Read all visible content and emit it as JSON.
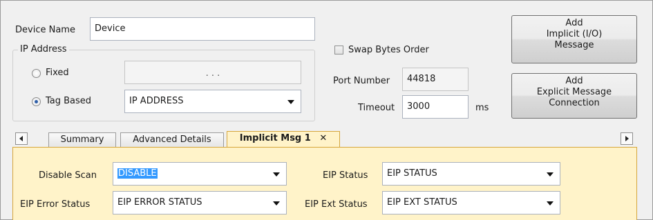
{
  "device": {
    "name_label": "Device Name",
    "name_value": "Device"
  },
  "ip_group": {
    "title": "IP Address",
    "fixed_label": "Fixed",
    "fixed_ip": ".          .          .",
    "tag_based_label": "Tag Based",
    "tag_value": "IP ADDRESS",
    "selected": "Tag Based"
  },
  "options": {
    "swap_bytes_label": "Swap Bytes Order",
    "swap_bytes_checked": false,
    "port_label": "Port Number",
    "port_value": "44818",
    "timeout_label": "Timeout",
    "timeout_value": "3000",
    "timeout_unit": "ms"
  },
  "buttons": {
    "add_implicit": [
      "Add",
      "Implicit (I/O)",
      "Message"
    ],
    "add_explicit": [
      "Add",
      "Explicit Message",
      "Connection"
    ]
  },
  "tabs": {
    "items": [
      "Summary",
      "Advanced Details",
      "Implicit Msg 1"
    ],
    "active": "Implicit Msg 1",
    "close_glyph": "✕"
  },
  "implicit_msg": {
    "disable_scan_label": "Disable Scan",
    "disable_scan_value": "DISABLE",
    "eip_error_label": "EIP Error Status",
    "eip_error_value": "EIP ERROR STATUS",
    "eip_status_label": "EIP Status",
    "eip_status_value": "EIP STATUS",
    "eip_ext_label": "EIP Ext Status",
    "eip_ext_value": "EIP EXT STATUS"
  },
  "colors": {
    "active_tab": "#fff3c9",
    "tab_border": "#d6a63a",
    "selection": "#3399ff"
  }
}
